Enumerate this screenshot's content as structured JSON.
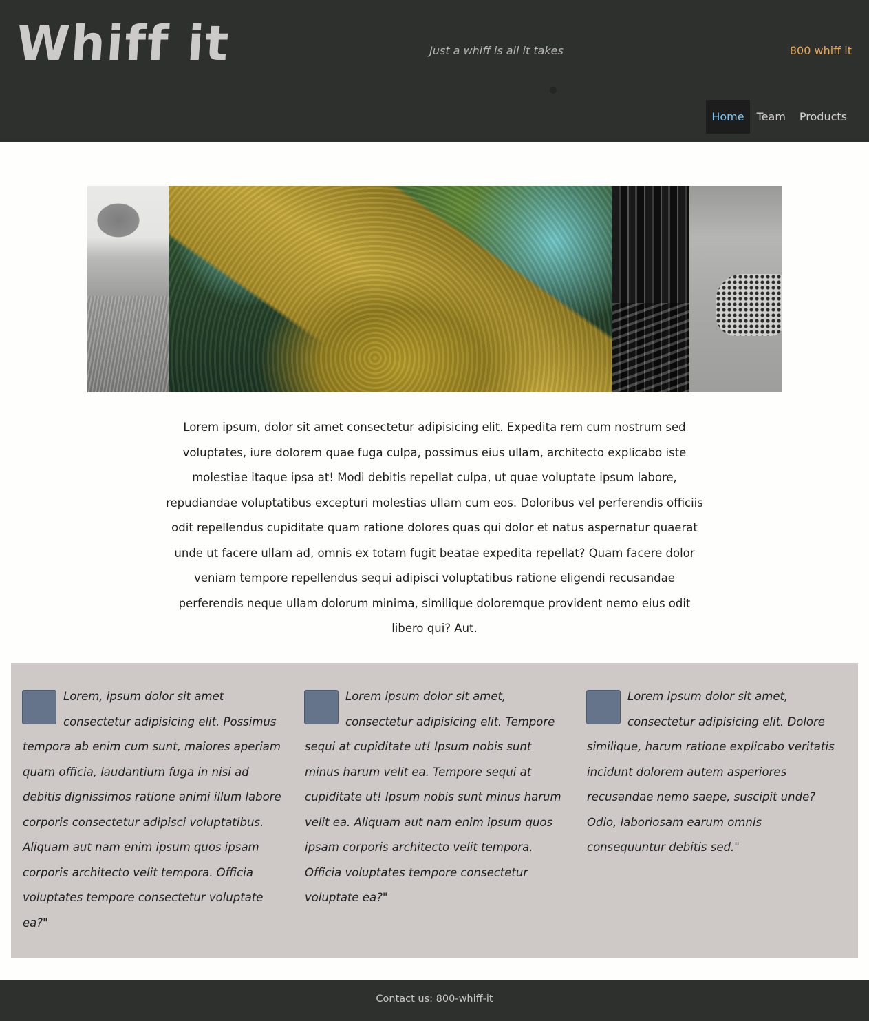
{
  "header": {
    "logo": "Whiff it",
    "tagline": "Just a whiff is all it takes",
    "phone": "800 whiff it",
    "nav": [
      {
        "label": "Home",
        "active": true
      },
      {
        "label": "Team",
        "active": false
      },
      {
        "label": "Products",
        "active": false
      }
    ]
  },
  "hero": {
    "panels": [
      "meadow-tree-photo",
      "mossy-tree-photo",
      "forest-trees-photo",
      "leopard-photo"
    ]
  },
  "intro": {
    "text": "Lorem ipsum, dolor sit amet consectetur adipisicing elit. Expedita rem cum nostrum sed voluptates, iure dolorem quae fuga culpa, possimus eius ullam, architecto explicabo iste molestiae itaque ipsa at! Modi debitis repellat culpa, ut quae voluptate ipsum labore, repudiandae voluptatibus excepturi molestias ullam cum eos. Doloribus vel perferendis officiis odit repellendus cupiditate quam ratione dolores quas qui dolor et natus aspernatur quaerat unde ut facere ullam ad, omnis ex totam fugit beatae expedita repellat? Quam facere dolor veniam tempore repellendus sequi adipisci voluptatibus ratione eligendi recusandae perferendis neque ullam dolorum minima, similique doloremque provident nemo eius odit libero qui? Aut."
  },
  "testimonials": [
    {
      "text": "Lorem, ipsum dolor sit amet consectetur adipisicing elit. Possimus tempora ab enim cum sunt, maiores aperiam quam officia, laudantium fuga in nisi ad debitis dignissimos ratione animi illum labore corporis consectetur adipisci voluptatibus. Aliquam aut nam enim ipsum quos ipsam corporis architecto velit tempora. Officia voluptates tempore consectetur voluptate ea?\""
    },
    {
      "text": "Lorem ipsum dolor sit amet, consectetur adipisicing elit. Tempore sequi at cupiditate ut! Ipsum nobis sunt minus harum velit ea. Tempore sequi at cupiditate ut! Ipsum nobis sunt minus harum velit ea. Aliquam aut nam enim ipsum quos ipsam corporis architecto velit tempora. Officia voluptates tempore consectetur voluptate ea?\""
    },
    {
      "text": "Lorem ipsum dolor sit amet, consectetur adipisicing elit. Dolore similique, harum ratione explicabo veritatis incidunt dolorem autem asperiores recusandae nemo saepe, suscipit unde? Odio, laboriosam earum omnis consequuntur debitis sed.\""
    }
  ],
  "footer": {
    "contact": "Contact us: 800-whiff-it"
  }
}
